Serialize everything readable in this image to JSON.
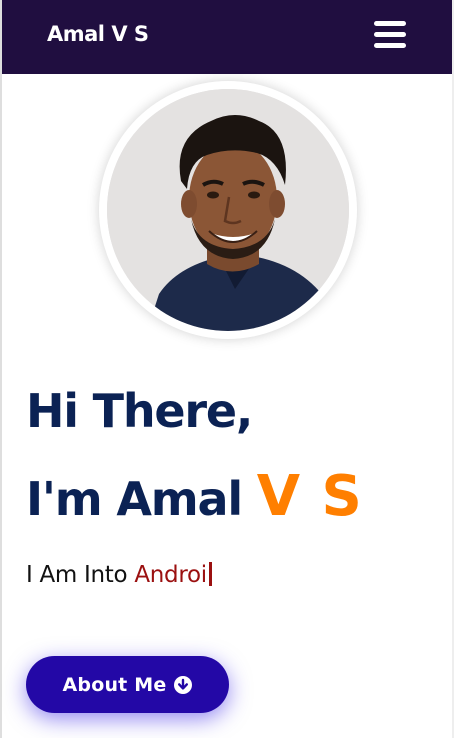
{
  "header": {
    "brand": "Amal V S",
    "background": "#200e40",
    "menu_icon": "hamburger-menu-icon"
  },
  "hero": {
    "greeting": "Hi There,",
    "intro_prefix": "I'm Amal ",
    "intro_accent": "V S",
    "into_prefix": "I Am Into ",
    "into_typed": "Androi",
    "accent_color": "#ff7f00",
    "title_color": "#0b2254",
    "typed_color": "#9b1010"
  },
  "about_button": {
    "label": "About Me",
    "icon": "arrow-down-circle-icon",
    "color": "#2308a6"
  }
}
